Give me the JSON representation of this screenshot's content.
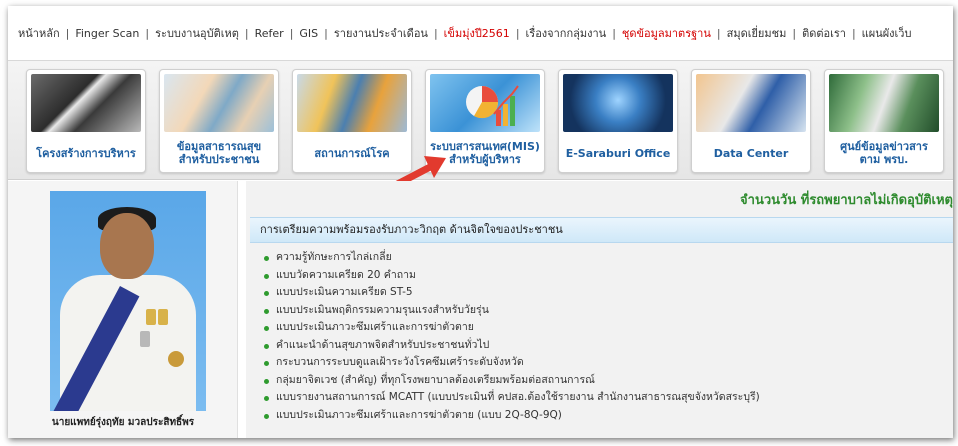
{
  "topnav": {
    "items": [
      {
        "label": "หน้าหลัก",
        "highlight": false
      },
      {
        "label": "Finger Scan",
        "highlight": false
      },
      {
        "label": "ระบบงานอุบัติเหตุ",
        "highlight": false
      },
      {
        "label": "Refer",
        "highlight": false
      },
      {
        "label": "GIS",
        "highlight": false
      },
      {
        "label": "รายงานประจำเดือน",
        "highlight": false
      },
      {
        "label": "เข็มมุ่งปี2561",
        "highlight": true
      },
      {
        "label": "เรื่องจากกลุ่มงาน",
        "highlight": false
      },
      {
        "label": "ชุดข้อมูลมาตรฐาน",
        "highlight": true
      },
      {
        "label": "สมุดเยี่ยมชม",
        "highlight": false
      },
      {
        "label": "ติดต่อเรา",
        "highlight": false
      },
      {
        "label": "แผนผังเว็บ",
        "highlight": false
      }
    ],
    "separator": "|",
    "highlight_color": "#d40000"
  },
  "banner": {
    "tiles": [
      {
        "label": "โครงสร้างการบริหาร"
      },
      {
        "label": "ข้อมูลสาธารณสุข สำหรับประชาชน"
      },
      {
        "label": "สถานการณ์โรค"
      },
      {
        "label": "ระบบสารสนเทศ(MIS) สำหรับผู้บริหาร"
      },
      {
        "label": "E-Saraburi Office"
      },
      {
        "label": "Data Center"
      },
      {
        "label": "ศูนย์ข้อมูลข่าวสาร ตาม พรบ."
      }
    ]
  },
  "left": {
    "caption": "นายแพทย์รุ่งฤทัย มวลประสิทธิ์พร"
  },
  "main": {
    "marquee": "จำนวนวัน ที่รถพยาบาลไม่เกิดอุบัติเหตุ",
    "section_title": "การเตรียมความพร้อมรองรับภาวะวิกฤต ด้านจิตใจของประชาชน",
    "items": [
      "ความรู้ทักษะการไกล่เกลี่ย",
      "แบบวัดความเครียด 20 คำถาม",
      "แบบประเมินความเครียด ST-5",
      "แบบประเมินพฤติกรรมความรุนแรงสำหรับวัยรุ่น",
      "แบบประเมินภาวะซึมเศร้าและการฆ่าตัวตาย",
      "คำแนะนำด้านสุขภาพจิตสำหรับประชาชนทั่วไป",
      "กระบวนการระบบดูแลเฝ้าระวังโรคซึมเศร้าระดับจังหวัด",
      "กลุ่มยาจิตเวช (สำคัญ) ที่ทุกโรงพยาบาลต้องเตรียมพร้อมต่อสถานการณ์",
      "แบบรายงานสถานการณ์ MCATT (แบบประเมินที่ คปสอ.ต้องใช้รายงาน สำนักงานสาธารณสุขจังหวัดสระบุรี)",
      "แบบประเมินภาวะซึมเศร้าและการฆ่าตัวตาย (แบบ 2Q-8Q-9Q)"
    ]
  },
  "colors": {
    "accent_blue": "#1f5fa0",
    "list_bullet": "#2e9b2e",
    "marquee_green": "#2e8b2e",
    "arrow_red": "#e23a2e"
  }
}
